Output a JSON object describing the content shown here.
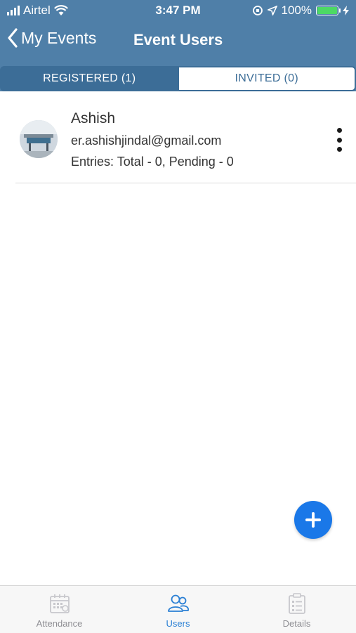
{
  "status_bar": {
    "carrier": "Airtel",
    "time": "3:47 PM",
    "battery": "100%"
  },
  "nav": {
    "back_label": "My Events",
    "title": "Event Users"
  },
  "tabs": [
    {
      "label": "REGISTERED (1)",
      "active": true
    },
    {
      "label": "INVITED (0)",
      "active": false
    }
  ],
  "users": [
    {
      "name": "Ashish",
      "email": "er.ashishjindal@gmail.com",
      "entries": "Entries: Total - 0, Pending - 0"
    }
  ],
  "tab_bar": [
    {
      "label": "Attendance",
      "icon": "calendar-icon",
      "active": false
    },
    {
      "label": "Users",
      "icon": "users-icon",
      "active": true
    },
    {
      "label": "Details",
      "icon": "clipboard-icon",
      "active": false
    }
  ],
  "colors": {
    "header": "#4f7fa8",
    "tab_active": "#3c6d97",
    "fab": "#1a78e8",
    "tab_bar_active": "#2a7fd4"
  }
}
